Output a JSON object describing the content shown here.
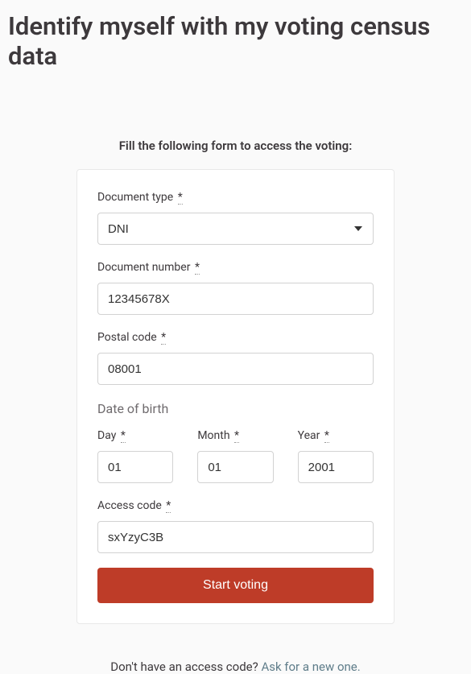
{
  "page": {
    "title": "Identify myself with my voting census data",
    "subtitle": "Fill the following form to access the voting:"
  },
  "form": {
    "document_type": {
      "label": "Document type",
      "required": "*",
      "value": "DNI"
    },
    "document_number": {
      "label": "Document number",
      "required": "*",
      "value": "12345678X"
    },
    "postal_code": {
      "label": "Postal code",
      "required": "*",
      "value": "08001"
    },
    "dob": {
      "title": "Date of birth",
      "day": {
        "label": "Day",
        "required": "*",
        "value": "01"
      },
      "month": {
        "label": "Month",
        "required": "*",
        "value": "01"
      },
      "year": {
        "label": "Year",
        "required": "*",
        "value": "2001"
      }
    },
    "access_code": {
      "label": "Access code",
      "required": "*",
      "value": "sxYzyC3B"
    },
    "submit": "Start voting"
  },
  "footer": {
    "prompt": "Don't have an access code? ",
    "link": "Ask for a new one."
  }
}
